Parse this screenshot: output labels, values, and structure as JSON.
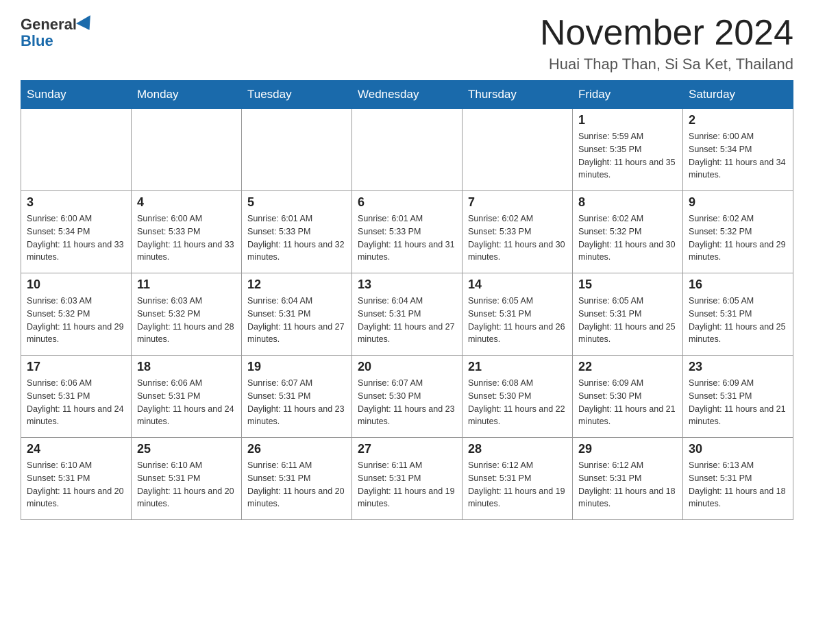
{
  "header": {
    "logo_general": "General",
    "logo_blue": "Blue",
    "month_title": "November 2024",
    "location": "Huai Thap Than, Si Sa Ket, Thailand"
  },
  "days_of_week": [
    "Sunday",
    "Monday",
    "Tuesday",
    "Wednesday",
    "Thursday",
    "Friday",
    "Saturday"
  ],
  "weeks": [
    [
      {
        "day": "",
        "sunrise": "",
        "sunset": "",
        "daylight": ""
      },
      {
        "day": "",
        "sunrise": "",
        "sunset": "",
        "daylight": ""
      },
      {
        "day": "",
        "sunrise": "",
        "sunset": "",
        "daylight": ""
      },
      {
        "day": "",
        "sunrise": "",
        "sunset": "",
        "daylight": ""
      },
      {
        "day": "",
        "sunrise": "",
        "sunset": "",
        "daylight": ""
      },
      {
        "day": "1",
        "sunrise": "Sunrise: 5:59 AM",
        "sunset": "Sunset: 5:35 PM",
        "daylight": "Daylight: 11 hours and 35 minutes."
      },
      {
        "day": "2",
        "sunrise": "Sunrise: 6:00 AM",
        "sunset": "Sunset: 5:34 PM",
        "daylight": "Daylight: 11 hours and 34 minutes."
      }
    ],
    [
      {
        "day": "3",
        "sunrise": "Sunrise: 6:00 AM",
        "sunset": "Sunset: 5:34 PM",
        "daylight": "Daylight: 11 hours and 33 minutes."
      },
      {
        "day": "4",
        "sunrise": "Sunrise: 6:00 AM",
        "sunset": "Sunset: 5:33 PM",
        "daylight": "Daylight: 11 hours and 33 minutes."
      },
      {
        "day": "5",
        "sunrise": "Sunrise: 6:01 AM",
        "sunset": "Sunset: 5:33 PM",
        "daylight": "Daylight: 11 hours and 32 minutes."
      },
      {
        "day": "6",
        "sunrise": "Sunrise: 6:01 AM",
        "sunset": "Sunset: 5:33 PM",
        "daylight": "Daylight: 11 hours and 31 minutes."
      },
      {
        "day": "7",
        "sunrise": "Sunrise: 6:02 AM",
        "sunset": "Sunset: 5:33 PM",
        "daylight": "Daylight: 11 hours and 30 minutes."
      },
      {
        "day": "8",
        "sunrise": "Sunrise: 6:02 AM",
        "sunset": "Sunset: 5:32 PM",
        "daylight": "Daylight: 11 hours and 30 minutes."
      },
      {
        "day": "9",
        "sunrise": "Sunrise: 6:02 AM",
        "sunset": "Sunset: 5:32 PM",
        "daylight": "Daylight: 11 hours and 29 minutes."
      }
    ],
    [
      {
        "day": "10",
        "sunrise": "Sunrise: 6:03 AM",
        "sunset": "Sunset: 5:32 PM",
        "daylight": "Daylight: 11 hours and 29 minutes."
      },
      {
        "day": "11",
        "sunrise": "Sunrise: 6:03 AM",
        "sunset": "Sunset: 5:32 PM",
        "daylight": "Daylight: 11 hours and 28 minutes."
      },
      {
        "day": "12",
        "sunrise": "Sunrise: 6:04 AM",
        "sunset": "Sunset: 5:31 PM",
        "daylight": "Daylight: 11 hours and 27 minutes."
      },
      {
        "day": "13",
        "sunrise": "Sunrise: 6:04 AM",
        "sunset": "Sunset: 5:31 PM",
        "daylight": "Daylight: 11 hours and 27 minutes."
      },
      {
        "day": "14",
        "sunrise": "Sunrise: 6:05 AM",
        "sunset": "Sunset: 5:31 PM",
        "daylight": "Daylight: 11 hours and 26 minutes."
      },
      {
        "day": "15",
        "sunrise": "Sunrise: 6:05 AM",
        "sunset": "Sunset: 5:31 PM",
        "daylight": "Daylight: 11 hours and 25 minutes."
      },
      {
        "day": "16",
        "sunrise": "Sunrise: 6:05 AM",
        "sunset": "Sunset: 5:31 PM",
        "daylight": "Daylight: 11 hours and 25 minutes."
      }
    ],
    [
      {
        "day": "17",
        "sunrise": "Sunrise: 6:06 AM",
        "sunset": "Sunset: 5:31 PM",
        "daylight": "Daylight: 11 hours and 24 minutes."
      },
      {
        "day": "18",
        "sunrise": "Sunrise: 6:06 AM",
        "sunset": "Sunset: 5:31 PM",
        "daylight": "Daylight: 11 hours and 24 minutes."
      },
      {
        "day": "19",
        "sunrise": "Sunrise: 6:07 AM",
        "sunset": "Sunset: 5:31 PM",
        "daylight": "Daylight: 11 hours and 23 minutes."
      },
      {
        "day": "20",
        "sunrise": "Sunrise: 6:07 AM",
        "sunset": "Sunset: 5:30 PM",
        "daylight": "Daylight: 11 hours and 23 minutes."
      },
      {
        "day": "21",
        "sunrise": "Sunrise: 6:08 AM",
        "sunset": "Sunset: 5:30 PM",
        "daylight": "Daylight: 11 hours and 22 minutes."
      },
      {
        "day": "22",
        "sunrise": "Sunrise: 6:09 AM",
        "sunset": "Sunset: 5:30 PM",
        "daylight": "Daylight: 11 hours and 21 minutes."
      },
      {
        "day": "23",
        "sunrise": "Sunrise: 6:09 AM",
        "sunset": "Sunset: 5:31 PM",
        "daylight": "Daylight: 11 hours and 21 minutes."
      }
    ],
    [
      {
        "day": "24",
        "sunrise": "Sunrise: 6:10 AM",
        "sunset": "Sunset: 5:31 PM",
        "daylight": "Daylight: 11 hours and 20 minutes."
      },
      {
        "day": "25",
        "sunrise": "Sunrise: 6:10 AM",
        "sunset": "Sunset: 5:31 PM",
        "daylight": "Daylight: 11 hours and 20 minutes."
      },
      {
        "day": "26",
        "sunrise": "Sunrise: 6:11 AM",
        "sunset": "Sunset: 5:31 PM",
        "daylight": "Daylight: 11 hours and 20 minutes."
      },
      {
        "day": "27",
        "sunrise": "Sunrise: 6:11 AM",
        "sunset": "Sunset: 5:31 PM",
        "daylight": "Daylight: 11 hours and 19 minutes."
      },
      {
        "day": "28",
        "sunrise": "Sunrise: 6:12 AM",
        "sunset": "Sunset: 5:31 PM",
        "daylight": "Daylight: 11 hours and 19 minutes."
      },
      {
        "day": "29",
        "sunrise": "Sunrise: 6:12 AM",
        "sunset": "Sunset: 5:31 PM",
        "daylight": "Daylight: 11 hours and 18 minutes."
      },
      {
        "day": "30",
        "sunrise": "Sunrise: 6:13 AM",
        "sunset": "Sunset: 5:31 PM",
        "daylight": "Daylight: 11 hours and 18 minutes."
      }
    ]
  ]
}
